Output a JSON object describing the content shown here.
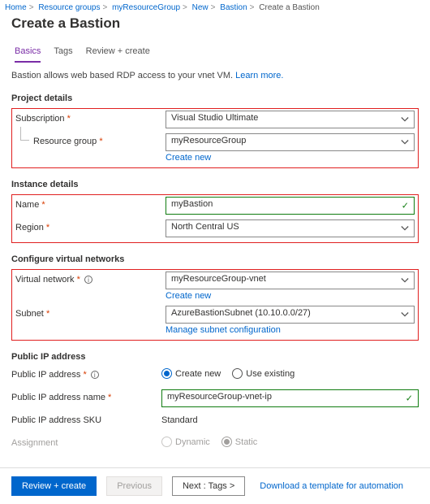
{
  "breadcrumb": {
    "items": [
      "Home",
      "Resource groups",
      "myResourceGroup",
      "New",
      "Bastion",
      "Create a Bastion"
    ]
  },
  "title": "Create a Bastion",
  "tabs": {
    "basics": "Basics",
    "tags": "Tags",
    "review": "Review + create"
  },
  "intro": {
    "text": "Bastion allows web based RDP access to your vnet VM.",
    "learn_more": "Learn more."
  },
  "section_headers": {
    "project": "Project details",
    "instance": "Instance details",
    "network": "Configure virtual networks",
    "publicip": "Public IP address"
  },
  "labels": {
    "subscription": "Subscription",
    "resource_group": "Resource group",
    "name": "Name",
    "region": "Region",
    "virtual_network": "Virtual network",
    "subnet": "Subnet",
    "public_ip": "Public IP address",
    "public_ip_name": "Public IP address name",
    "public_ip_sku": "Public IP address SKU",
    "assignment": "Assignment"
  },
  "values": {
    "subscription": "Visual Studio Ultimate",
    "resource_group": "myResourceGroup",
    "name": "myBastion",
    "region": "North Central US",
    "virtual_network": "myResourceGroup-vnet",
    "subnet": "AzureBastionSubnet (10.10.0.0/27)",
    "public_ip_name": "myResourceGroup-vnet-ip",
    "public_ip_sku": "Standard"
  },
  "links": {
    "create_new": "Create new",
    "manage_subnet": "Manage subnet configuration",
    "download_template": "Download a template for automation"
  },
  "radios": {
    "create_new": "Create new",
    "use_existing": "Use existing",
    "dynamic": "Dynamic",
    "static": "Static"
  },
  "buttons": {
    "review_create": "Review + create",
    "previous": "Previous",
    "next": "Next : Tags >"
  }
}
